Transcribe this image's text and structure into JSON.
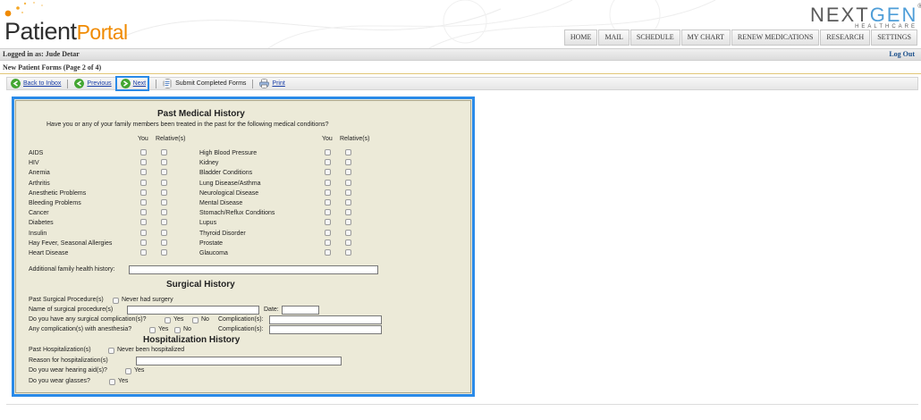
{
  "header": {
    "logo_patient": "Patient",
    "logo_portal": "Portal",
    "brand_next": "NEXT",
    "brand_gen": "GEN",
    "brand_reg": "®",
    "brand_sub": "HEALTHCARE",
    "nav": [
      "HOME",
      "MAIL",
      "SCHEDULE",
      "MY CHART",
      "RENEW MEDICATIONS",
      "RESEARCH",
      "SETTINGS"
    ]
  },
  "loginbar": {
    "logged_in": "Logged in as: Jude Detar",
    "logout": "Log Out"
  },
  "page_title": "New Patient Forms (Page 2 of 4)",
  "toolbar": {
    "back": "Back to Inbox",
    "previous": "Previous",
    "next": "Next",
    "submit": "Submit Completed Forms",
    "print": "Print"
  },
  "form": {
    "pmh_title": "Past Medical History",
    "pmh_question": "Have you or any of your family members been treated in the past for the following medical conditions?",
    "col_you": "You",
    "col_relative": "Relative(s)",
    "left_conditions": [
      "AIDS",
      "HIV",
      "Anemia",
      "Arthritis",
      "Anesthetic Problems",
      "Bleeding Problems",
      "Cancer",
      "Diabetes",
      "Insulin",
      "Hay Fever, Seasonal Allergies",
      "Heart Disease"
    ],
    "right_conditions": [
      "High Blood Pressure",
      "Kidney",
      "Bladder Conditions",
      "Lung Disease/Asthma",
      "Neurological Disease",
      "Mental Disease",
      "Stomach/Reflux Conditions",
      "Lupus",
      "Thyroid Disorder",
      "Prostate",
      "Glaucoma"
    ],
    "additional_family": "Additional family health history:",
    "surg_title": "Surgical History",
    "past_surgical": "Past Surgical Procedure(s)",
    "never_surgery": "Never had surgery",
    "name_surgical": "Name of surgical procedure(s)",
    "date_label": "Date:",
    "surg_complication_q": "Do you have any surgical complication(s)?",
    "yes": "Yes",
    "no": "No",
    "complications_label": "Complication(s):",
    "anesthesia_q": "Any complication(s) with anesthesia?",
    "hosp_title": "Hospitalization History",
    "past_hosp": "Past Hospitalization(s)",
    "never_hosp": "Never been hospitalized",
    "reason_hosp": "Reason for hospitalization(s)",
    "hearing_q": "Do you wear hearing aid(s)?",
    "glasses_q": "Do you wear glasses?"
  }
}
